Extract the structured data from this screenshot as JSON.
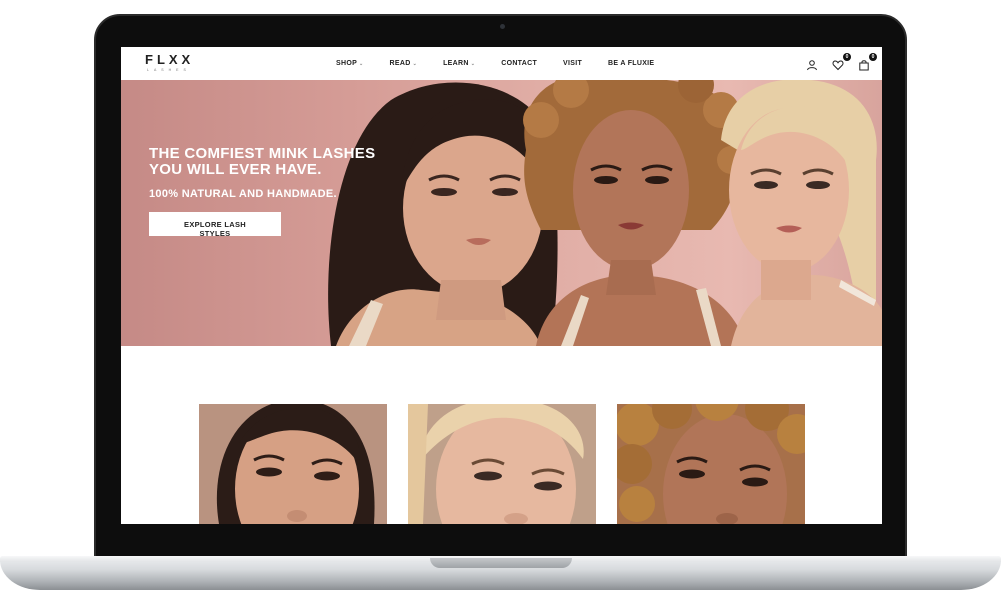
{
  "brand": {
    "name": "FLXX",
    "subtitle": "LASHES"
  },
  "nav": {
    "items": [
      {
        "label": "SHOP",
        "has_dropdown": true
      },
      {
        "label": "READ",
        "has_dropdown": true
      },
      {
        "label": "LEARN",
        "has_dropdown": true
      },
      {
        "label": "CONTACT",
        "has_dropdown": false
      },
      {
        "label": "VISIT",
        "has_dropdown": false
      },
      {
        "label": "BE A FLUXIE",
        "has_dropdown": false
      }
    ],
    "icons": {
      "account": "user-icon",
      "wishlist": "heart-icon",
      "wishlist_count": "0",
      "cart": "bag-icon",
      "cart_count": "0"
    }
  },
  "hero": {
    "headline": "THE COMFIEST MINK LASHES\nYOU WILL EVER HAVE.",
    "subheadline": "100% NATURAL AND HANDMADE.",
    "cta_label": "EXPLORE LASH STYLES",
    "background_color": "#d59c96"
  },
  "gallery": {
    "cards": [
      {
        "name": "model-closeup-1"
      },
      {
        "name": "model-closeup-2"
      },
      {
        "name": "model-closeup-3"
      }
    ]
  },
  "colors": {
    "accent": "#d59c96",
    "text_dark": "#222222",
    "white": "#ffffff"
  }
}
